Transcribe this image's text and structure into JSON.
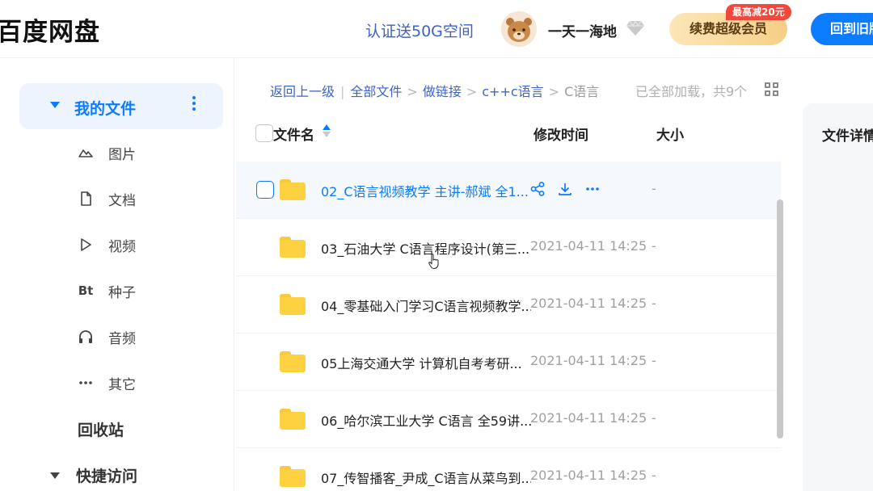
{
  "header": {
    "logo": "百度网盘",
    "promo": "认证送50G空间",
    "username": "一天一海地",
    "renew_button": "续费超级会员",
    "renew_badge": "最高减20元",
    "back_old_button": "回到旧版"
  },
  "sidebar": {
    "my_files": "我的文件",
    "categories": [
      {
        "label": "图片",
        "icon": "image-icon"
      },
      {
        "label": "文档",
        "icon": "document-icon"
      },
      {
        "label": "视频",
        "icon": "video-play-icon"
      },
      {
        "label": "种子",
        "icon": "bt-icon",
        "glyph": "Bt"
      },
      {
        "label": "音频",
        "icon": "headphones-icon"
      },
      {
        "label": "其它",
        "icon": "more-dots-icon"
      }
    ],
    "recycle": "回收站",
    "quick_access": "快捷访问"
  },
  "breadcrumb": {
    "back": "返回上一级",
    "items": [
      "全部文件",
      "做链接",
      "c++c语言"
    ],
    "current": "C语言"
  },
  "load_info": "已全部加载，共9个",
  "table": {
    "headers": {
      "name": "文件名",
      "time": "修改时间",
      "size": "大小"
    },
    "rows": [
      {
        "name": "02_C语言视频教学 主讲-郝斌 全1...",
        "time": "",
        "size": "-",
        "hovered": true
      },
      {
        "name": "03_石油大学 C语言程序设计(第三...",
        "time": "2021-04-11 14:25",
        "size": "-"
      },
      {
        "name": "04_零基础入门学习C语言视频教学...",
        "time": "2021-04-11 14:25",
        "size": "-"
      },
      {
        "name": "05上海交通大学 计算机自考考研...",
        "time": "2021-04-11 14:25",
        "size": "-"
      },
      {
        "name": "06_哈尔滨工业大学 C语言 全59讲...",
        "time": "2021-04-11 14:25",
        "size": "-"
      },
      {
        "name": "07_传智播客_尹成_C语言从菜鸟到...",
        "time": "2021-04-11 14:25",
        "size": "-"
      }
    ]
  },
  "detail_panel": {
    "title": "文件详情"
  },
  "colors": {
    "accent": "#0b7bff",
    "link": "#3d64c9",
    "folder": "#fdd13f",
    "badge": "#f2473a"
  }
}
